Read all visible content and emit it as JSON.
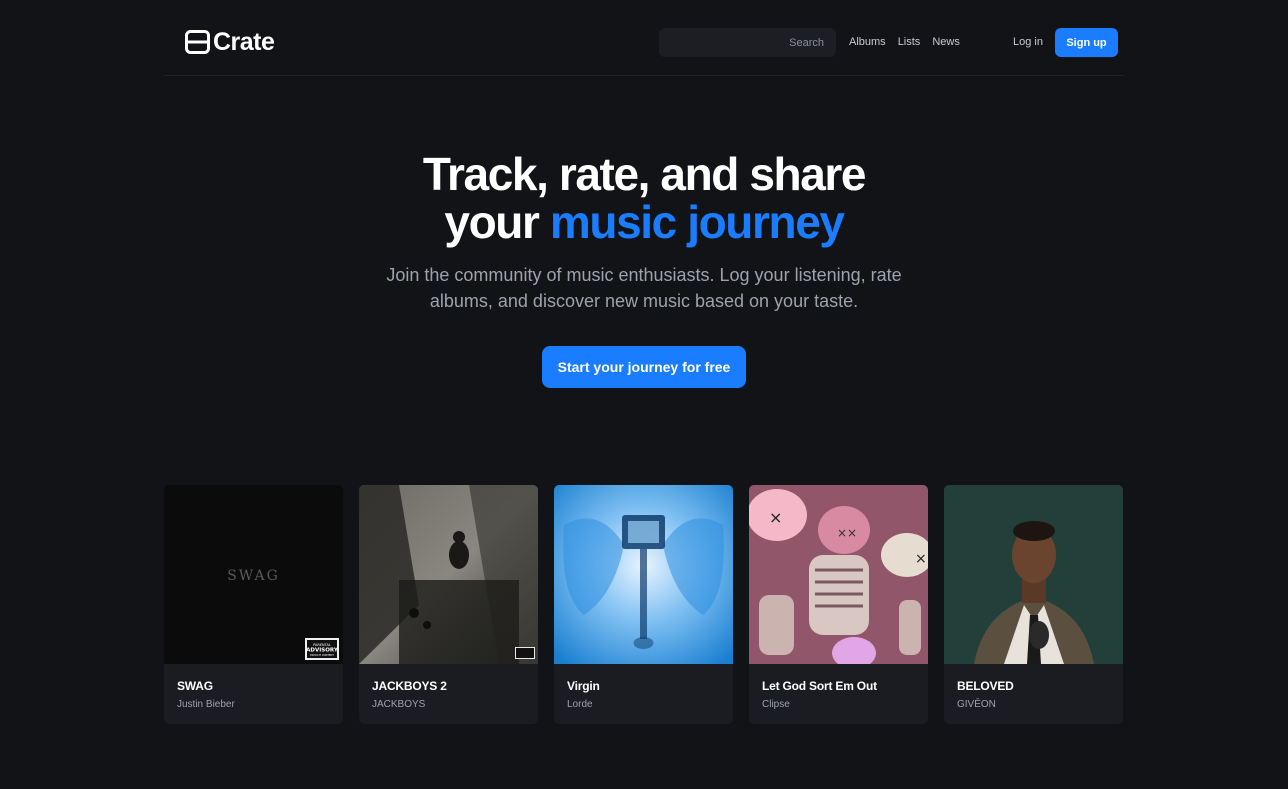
{
  "brand": {
    "name": "Crate",
    "accent": "#1a7cff"
  },
  "nav": {
    "search_placeholder": "Search",
    "links": [
      "Albums",
      "Lists",
      "News"
    ],
    "login": "Log in",
    "signup": "Sign up"
  },
  "hero": {
    "title_line1": "Track, rate, and share",
    "title_line2_plain": "your ",
    "title_line2_accent": "music journey",
    "subtitle_line1": "Join the community of music enthusiasts. Log your listening, rate",
    "subtitle_line2": "albums, and discover new music based on your taste.",
    "cta": "Start your journey for free"
  },
  "albums": [
    {
      "title": "SWAG",
      "artist": "Justin Bieber",
      "cover_text": "SWAG",
      "badge_line1": "PARENTAL",
      "badge_line2": "ADVISORY",
      "badge_line3": "EXPLICIT CONTENT"
    },
    {
      "title": "JACKBOYS 2",
      "artist": "JACKBOYS"
    },
    {
      "title": "Virgin",
      "artist": "Lorde"
    },
    {
      "title": "Let God Sort Em Out",
      "artist": "Clipse"
    },
    {
      "title": "BELOVED",
      "artist": "GIVĒON"
    }
  ]
}
